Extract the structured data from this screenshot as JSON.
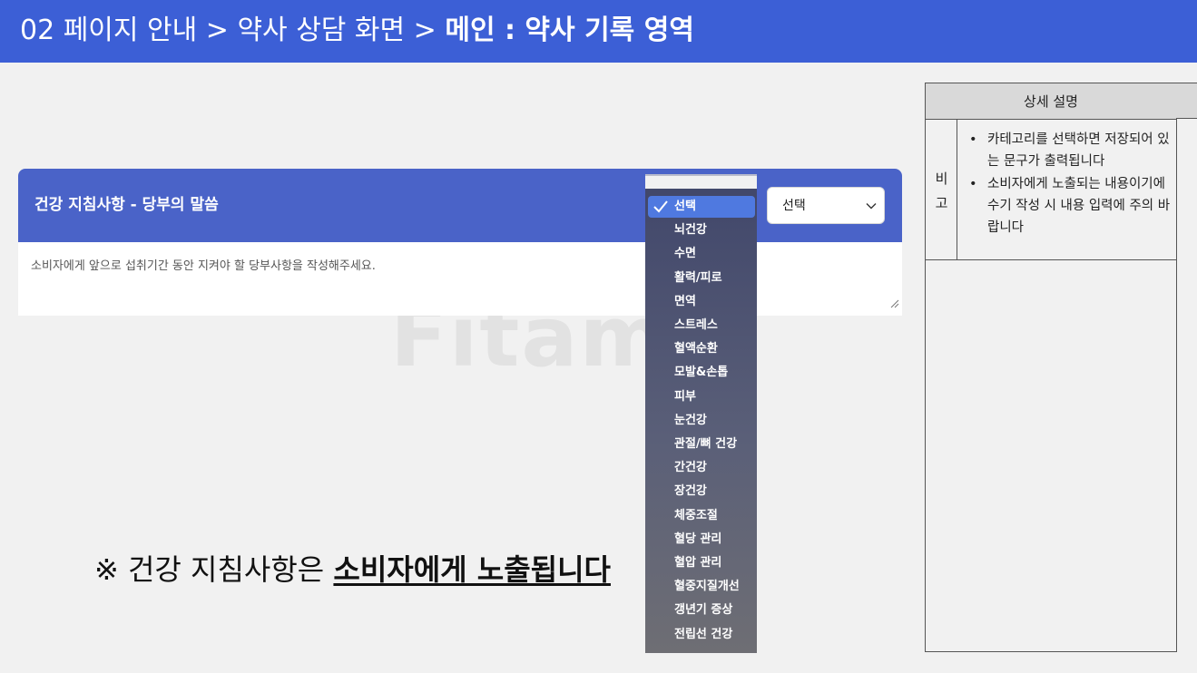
{
  "header": {
    "breadcrumb_plain": "02 페이지 안내 > 약사 상담 화면 > ",
    "breadcrumb_bold": "메인 : 약사 기록 영역"
  },
  "panel": {
    "title": "건강 지침사항 - 당부의 말씀",
    "select_value": "선택",
    "textarea_placeholder": "소비자에게 앞으로 섭취기간 동안 지켜야 할 당부사항을 작성해주세요."
  },
  "watermark": "Fitamin",
  "dropdown": {
    "selected": "선택",
    "options": [
      "선택",
      "뇌건강",
      "수면",
      "활력/피로",
      "면역",
      "스트레스",
      "혈액순환",
      "모발&손톱",
      "피부",
      "눈건강",
      "관절/뼈 건강",
      "간건강",
      "장건강",
      "체중조절",
      "혈당 관리",
      "혈압 관리",
      "혈중지질개선",
      "갱년기 증상",
      "전립선 건강"
    ]
  },
  "note": {
    "prefix": "※ 건강 지침사항은 ",
    "emphasis": "소비자에게 노출됩니다"
  },
  "description": {
    "header": "상세 설명",
    "row_label_1": "비",
    "row_label_2": "고",
    "bullet_mark": "•",
    "items": [
      "카테고리를 선택하면 저장되어 있는 문구가 출력됩니다",
      "소비자에게 노출되는 내용이기에 수기 작성 시 내용 입력에 주의 바랍니다"
    ]
  },
  "colors": {
    "topbar": "#3c5fd6",
    "panel_header": "#4a63c8",
    "dropdown_selected": "#4f79e0"
  }
}
